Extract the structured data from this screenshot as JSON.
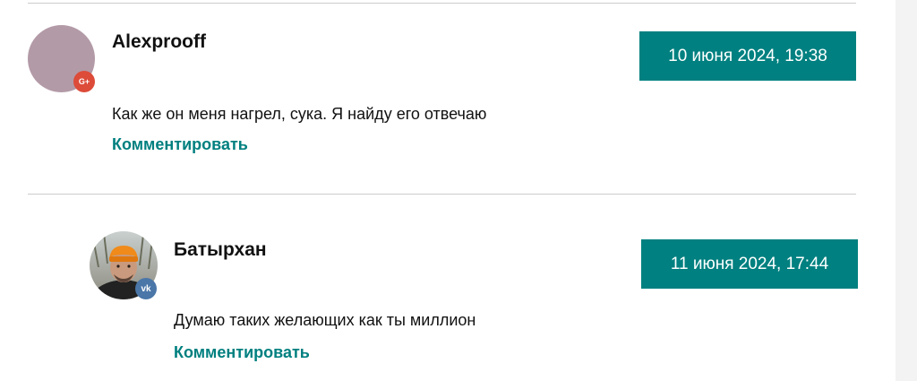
{
  "colors": {
    "accent": "#008080",
    "link": "#007f7f",
    "google_badge": "#dd4b39",
    "vk_badge": "#4a76a8",
    "avatar_placeholder": "#b39aa7"
  },
  "comments": [
    {
      "author": "Alexprooff",
      "date": "10 июня 2024, 19:38",
      "text": "Как же он меня нагрел, сука. Я найду его отвечаю",
      "reply_label": "Комментировать",
      "social_badge": {
        "icon": "google-plus-icon",
        "label": "G+"
      }
    },
    {
      "author": "Батырхан",
      "date": "11 июня 2024, 17:44",
      "text": "Думаю таких желающих как ты миллион",
      "reply_label": "Комментировать",
      "social_badge": {
        "icon": "vk-icon",
        "label": "vk"
      }
    }
  ]
}
